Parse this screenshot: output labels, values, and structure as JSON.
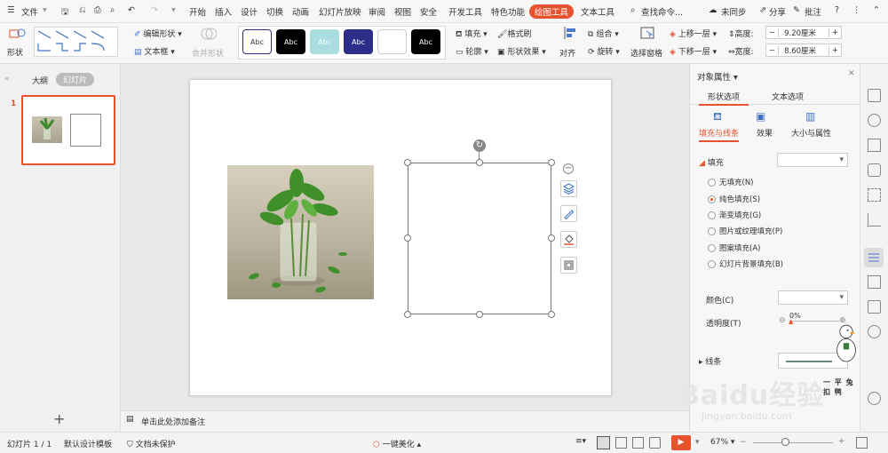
{
  "menubar": {
    "file_label": "文件",
    "tabs": [
      "开始",
      "插入",
      "设计",
      "切换",
      "动画",
      "幻灯片放映",
      "审阅",
      "视图",
      "安全",
      "开发工具",
      "特色功能"
    ],
    "active_tab": "绘图工具",
    "text_tool_tab": "文本工具",
    "search_label": "查找命令...",
    "sync_label": "未同步",
    "share_label": "分享",
    "comment_label": "批注",
    "help_label": "?",
    "accent_color": "#e8532f"
  },
  "ribbon": {
    "shape_label": "形状",
    "edit_shape_label": "编辑形状",
    "textbox_label": "文本框",
    "merge_shape_label": "合并形状",
    "style_samples": [
      "Abc",
      "Abc",
      "Abc",
      "Abc",
      "Abc",
      "Abc"
    ],
    "fill_label": "填充",
    "format_painter_label": "格式刷",
    "outline_label": "轮廓",
    "shape_effect_label": "形状效果",
    "align_label": "对齐",
    "group_label": "组合",
    "rotate_label": "旋转",
    "selection_pane_label": "选择窗格",
    "bring_forward_label": "上移一层",
    "send_backward_label": "下移一层",
    "height_label": "高度:",
    "height_value": "9.20厘米",
    "width_label": "宽度:",
    "width_value": "8.60厘米"
  },
  "leftpanel": {
    "outline_tab": "大纲",
    "slides_tab": "幻灯片",
    "slide_number": "1",
    "add_button": "+"
  },
  "notes": {
    "placeholder": "单击此处添加备注"
  },
  "rightpanel": {
    "title": "对象属性",
    "tab_shape": "形状选项",
    "tab_text": "文本选项",
    "subtab_fill": "填充与线条",
    "subtab_effect": "效果",
    "subtab_size": "大小与属性",
    "fill_section": "填充",
    "fill_options": [
      "无填充(N)",
      "纯色填充(S)",
      "渐变填充(G)",
      "图片或纹理填充(P)",
      "图案填充(A)",
      "幻灯片背景填充(B)"
    ],
    "selected_fill": 1,
    "color_label": "颜色(C)",
    "transparency_label": "透明度(T)",
    "transparency_value": "0%",
    "line_section": "线条"
  },
  "statusbar": {
    "slide_info": "幻灯片 1 / 1",
    "template": "默认设计模板",
    "protect": "文档未保护",
    "beautify": "一键美化",
    "zoom": "67%"
  },
  "watermark": {
    "brand": "Baidu经验",
    "url": "jingyan.baidu.com",
    "sticker_text": "一 平 兔 扣 鸭"
  }
}
